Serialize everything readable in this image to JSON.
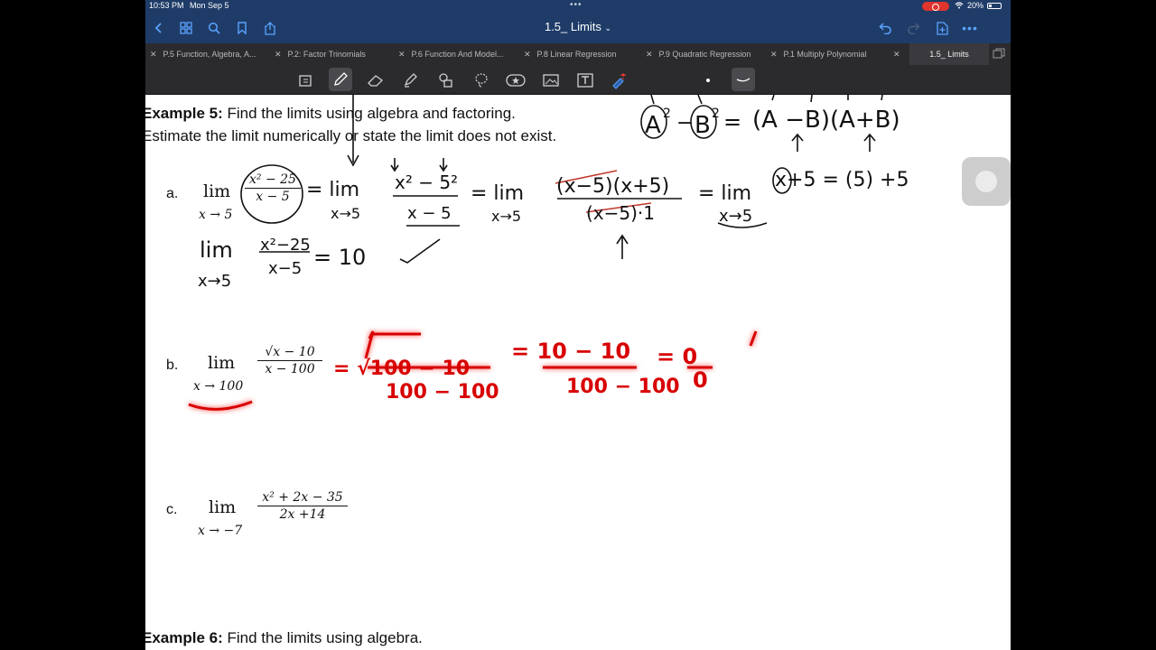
{
  "status": {
    "time": "10:53 PM",
    "date": "Mon Sep 5",
    "battery": "20%"
  },
  "header": {
    "title": "1.5_ Limits"
  },
  "tabs": [
    {
      "label": "P.5 Function, Algebra, A..."
    },
    {
      "label": "P.2: Factor Trinomials"
    },
    {
      "label": "P.6 Function And Model..."
    },
    {
      "label": "P.8 Linear Regression"
    },
    {
      "label": "P.9 Quadratic Regression"
    },
    {
      "label": "P.1 Multiply Polynomial"
    },
    {
      "label": "1.5_ Limits"
    }
  ],
  "colors": {
    "header_bg": "#1f3c68",
    "ink_red": "#d80000",
    "tab_bg": "#2b2b2e"
  },
  "note": {
    "example5_title": "Example 5:",
    "example5_text": " Find the limits using algebra and factoring.",
    "example5_line2": "Estimate the limit numerically or state the limit does not exist.",
    "a_label": "a.",
    "a_lim": "lim",
    "a_sub": "x → 5",
    "a_num": "x² − 25",
    "a_den": "x − 5",
    "b_label": "b.",
    "b_lim": "lim",
    "b_sub": "x → 100",
    "b_num": "√x − 10",
    "b_den": "x − 100",
    "c_label": "c.",
    "c_lim": "lim",
    "c_sub": "x → −7",
    "c_num": "x² + 2x − 35",
    "c_den": "2x +14",
    "example6_title": "Example 6:",
    "example6_text": " Find the limits using algebra."
  },
  "ink": {
    "identity": [
      "A",
      "2",
      "−",
      "B",
      "2",
      "=",
      "(A −B)(A+B)"
    ],
    "a_step1": [
      "= lim",
      "x→5",
      "x² − 5²",
      "x − 5"
    ],
    "a_step2": [
      "= lim",
      "x→5",
      "(x−5)(x+5)",
      "(x−5)·1"
    ],
    "a_step3": [
      "= lim",
      "x→5",
      "x+5 = (5) +5"
    ],
    "a_result": [
      "lim",
      "x→5",
      "x²−25",
      "x−5",
      "= 10"
    ],
    "b_red": [
      "= √100 − 10",
      "100 − 100",
      "= 10 − 10",
      "100 − 100",
      "= 0",
      "0"
    ]
  }
}
